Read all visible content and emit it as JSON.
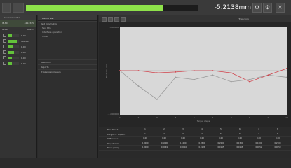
{
  "toolbar": {
    "readout": "-5.2138mm",
    "progress_fraction": 0.8
  },
  "left_panel": {
    "header": "Device monitor",
    "devices": [
      {
        "name": "IE-80",
        "value": "4212345"
      },
      {
        "name": "IE-80",
        "value": "4045c"
      }
    ],
    "gauges": [
      {
        "value": "0.00",
        "fill": 0.3
      },
      {
        "value": "100.00",
        "fill": 0.8
      },
      {
        "value": "0.00",
        "fill": 0.4
      },
      {
        "value": "0.00",
        "fill": 0.5
      },
      {
        "value": "0.00",
        "fill": 0.35
      },
      {
        "value": "0.00",
        "fill": 0.3
      }
    ]
  },
  "middle_panel": {
    "header": "Define test",
    "sections": [
      {
        "title": "Test information",
        "fields": [
          "Test title",
          "Interface operation",
          "Notes"
        ]
      },
      {
        "title": "Reactions",
        "fields": []
      },
      {
        "title": "Reports",
        "fields": []
      },
      {
        "title": "Trigger parameters",
        "fields": []
      }
    ]
  },
  "chart_title": "Trajectory",
  "chart_data": {
    "type": "line",
    "ylim": [
      -1,
      1
    ],
    "x_ticks": [
      "1",
      "2",
      "3",
      "4",
      "5",
      "6",
      "7",
      "8",
      "9",
      "10"
    ],
    "y_ticks": [
      "1.000000",
      "-1.000000"
    ],
    "xlabel": "Target steps",
    "ylabel": "Distance mm",
    "series": [
      {
        "values": [
          0.0,
          -0.35,
          -0.65,
          -0.15,
          -0.2,
          -0.1,
          -0.25,
          -0.2,
          -0.1,
          -0.15
        ]
      },
      {
        "values": [
          0.0,
          0.0,
          -0.05,
          -0.03,
          0.0,
          0.0,
          -0.05,
          -0.25,
          -0.1,
          0.05
        ]
      }
    ]
  },
  "table": {
    "row_headers": [
      "Nbr # of S",
      "Length # VS/Mm",
      "Difference",
      "Target mm",
      "Error (mm)"
    ],
    "cols": 8,
    "cells": [
      [
        "1",
        "2",
        "3",
        "4",
        "5",
        "6",
        "7",
        "8"
      ],
      [
        "1",
        "2",
        "3",
        "4",
        "5",
        "6",
        "7",
        "8"
      ],
      [
        "0.00",
        "0.00",
        "0.00",
        "0.00",
        "0.00",
        "0.00",
        "0.00",
        "0.00"
      ],
      [
        "0.0000",
        "-0.1000",
        "0.1000",
        "0.0500",
        "0.2000",
        "0.1500",
        "0.1000",
        "0.2500"
      ],
      [
        "0.0000",
        "-0.0049",
        "-0.0016",
        "0.0126",
        "0.0165",
        "0.0158",
        "0.0052",
        "0.0059"
      ]
    ]
  }
}
